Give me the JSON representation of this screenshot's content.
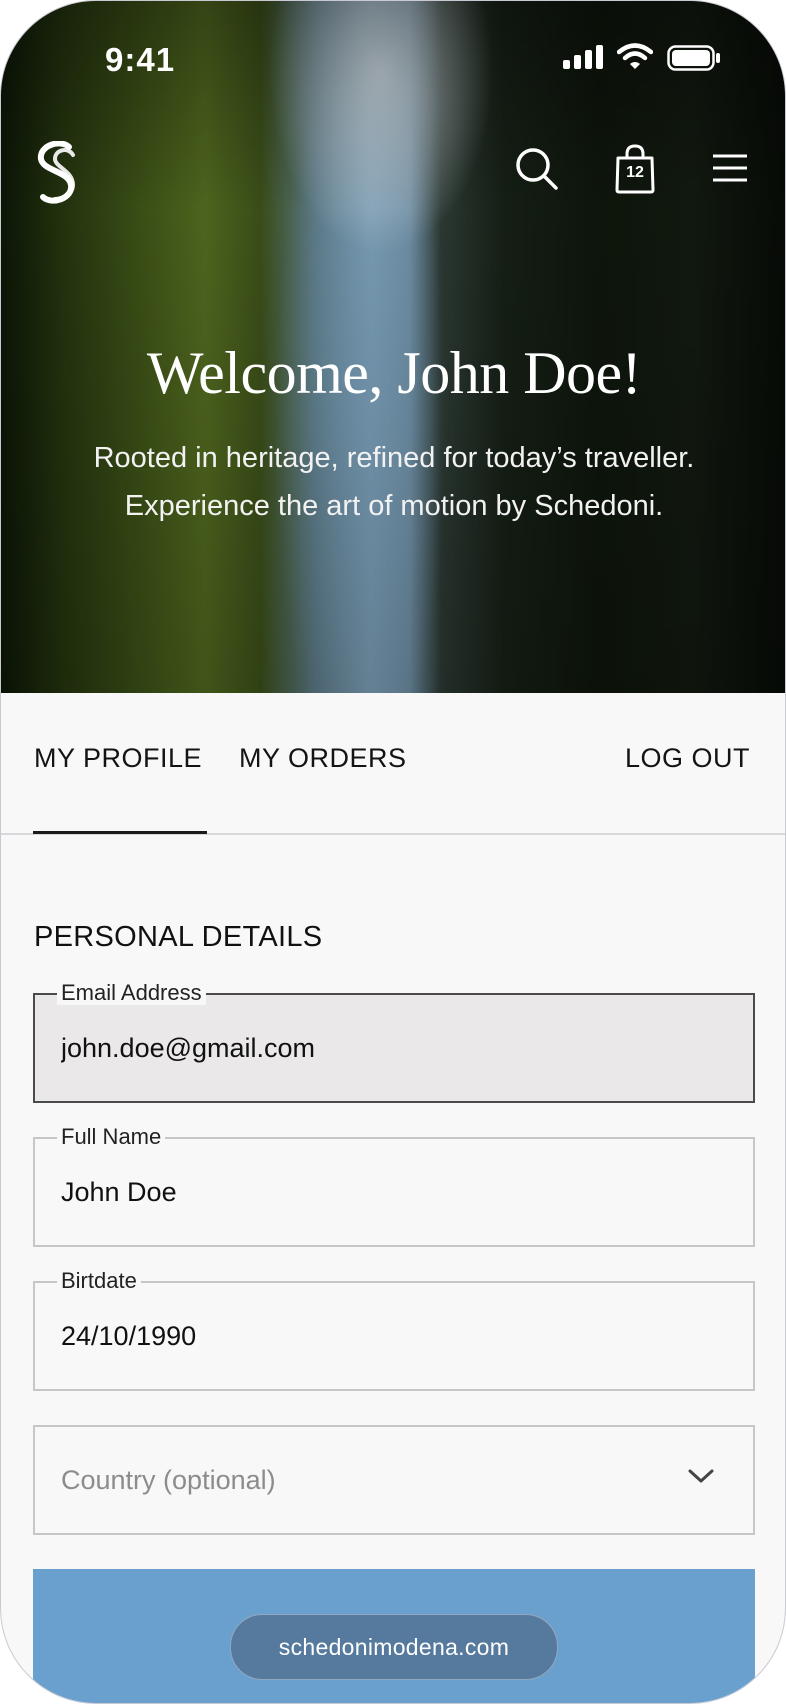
{
  "status_bar": {
    "time": "9:41"
  },
  "header": {
    "logo_icon": "schedoni-s-logo-icon",
    "search_icon": "search-icon",
    "bag_icon": "shopping-bag-icon",
    "bag_count": "12",
    "menu_icon": "hamburger-menu-icon"
  },
  "hero": {
    "title": "Welcome, John Doe!",
    "tagline_line1": "Rooted in heritage, refined for today’s traveller.",
    "tagline_line2": "Experience the art of motion by Schedoni."
  },
  "tabs": {
    "profile": "MY PROFILE",
    "orders": "MY ORDERS",
    "logout": "LOG OUT",
    "active": "profile"
  },
  "personal_details": {
    "title": "PERSONAL DETAILS",
    "email": {
      "label": "Email Address",
      "value": "john.doe@gmail.com"
    },
    "full_name": {
      "label": "Full Name",
      "value": "John Doe"
    },
    "birthdate": {
      "label": "Birtdate",
      "value": "24/10/1990"
    },
    "country": {
      "placeholder": "Country (optional)"
    }
  },
  "browser": {
    "url": "schedonimodena.com"
  },
  "colors": {
    "primary_button": "#6aa0ce",
    "background": "#f8f8f8",
    "text": "#141414"
  }
}
